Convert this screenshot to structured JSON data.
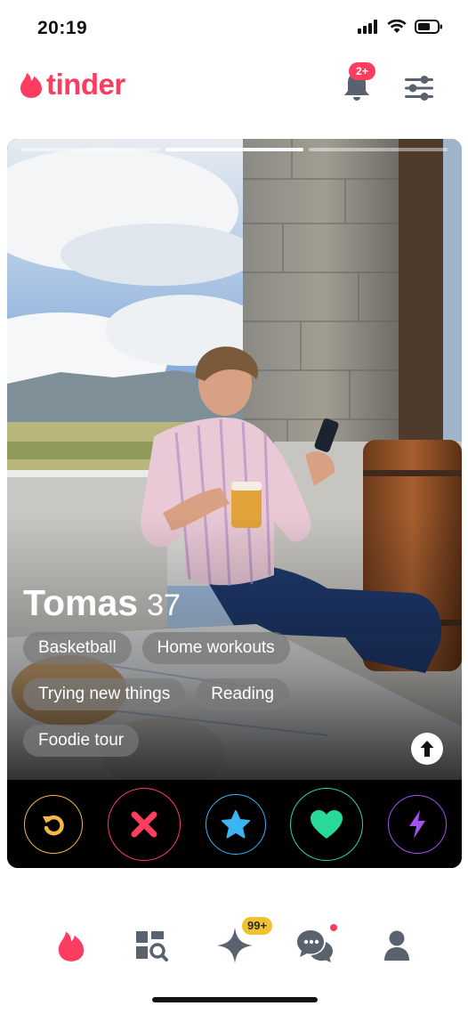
{
  "status_bar": {
    "time": "20:19"
  },
  "header": {
    "logo": "tinder",
    "notification_badge": "2+"
  },
  "profile": {
    "name": "Tomas",
    "age": "37",
    "photo_count": 3,
    "active_photo_index": 1,
    "interests": [
      "Basketball",
      "Home workouts",
      "Trying new things",
      "Reading",
      "Foodie tour"
    ]
  },
  "actions": [
    {
      "name": "rewind",
      "icon": "rewind-icon",
      "color": "#f5b748"
    },
    {
      "name": "nope",
      "icon": "close-icon",
      "color": "#fd3d5f"
    },
    {
      "name": "super-like",
      "icon": "star-icon",
      "color": "#3ab4f2"
    },
    {
      "name": "like",
      "icon": "heart-icon",
      "color": "#28d99a"
    },
    {
      "name": "boost",
      "icon": "lightning-icon",
      "color": "#a44ff0"
    }
  ],
  "nav": {
    "items": [
      "flame-icon",
      "explore-icon",
      "gold-sparkle-icon",
      "chat-icon",
      "profile-icon"
    ],
    "likes_badge": "99+"
  },
  "colors": {
    "brand": "#fd3d5f",
    "nav_inactive": "#5a6270",
    "badge_gold": "#f0c230"
  }
}
